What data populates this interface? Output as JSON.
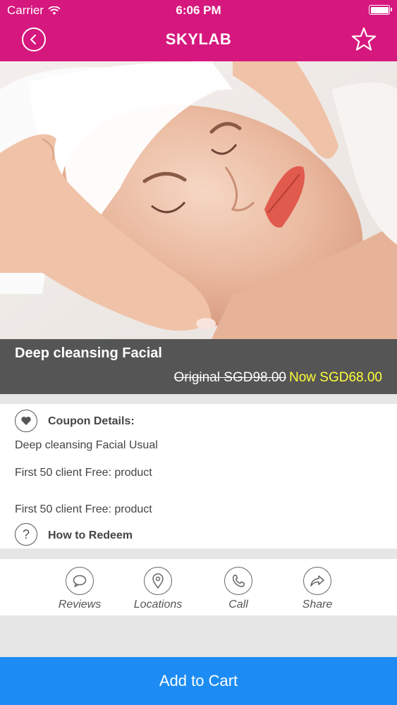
{
  "status_bar": {
    "carrier": "Carrier",
    "time": "6:06 PM"
  },
  "navbar": {
    "title": "SKYLAB",
    "back_icon": "chevron-left-icon",
    "favorite_icon": "star-outline-icon"
  },
  "colors": {
    "brand": "#d6177e",
    "accent_price": "#ffff3a",
    "button": "#1c8cf4",
    "title_bar": "#555555"
  },
  "deal": {
    "title": "Deep cleansing Facial",
    "original_price": "Original SGD98.00",
    "now_price": "Now SGD68.00"
  },
  "coupon": {
    "label": "Coupon Details:",
    "lines": [
      "Deep cleansing Facial Usual",
      "First 50 client Free: product",
      "First 50 client Free: product"
    ]
  },
  "redeem": {
    "label": "How to Redeem"
  },
  "actions": [
    {
      "label": "Reviews",
      "icon": "speech-bubble-icon"
    },
    {
      "label": "Locations",
      "icon": "location-pin-icon"
    },
    {
      "label": "Call",
      "icon": "phone-icon"
    },
    {
      "label": "Share",
      "icon": "share-arrow-icon"
    }
  ],
  "cart": {
    "label": "Add to Cart"
  }
}
